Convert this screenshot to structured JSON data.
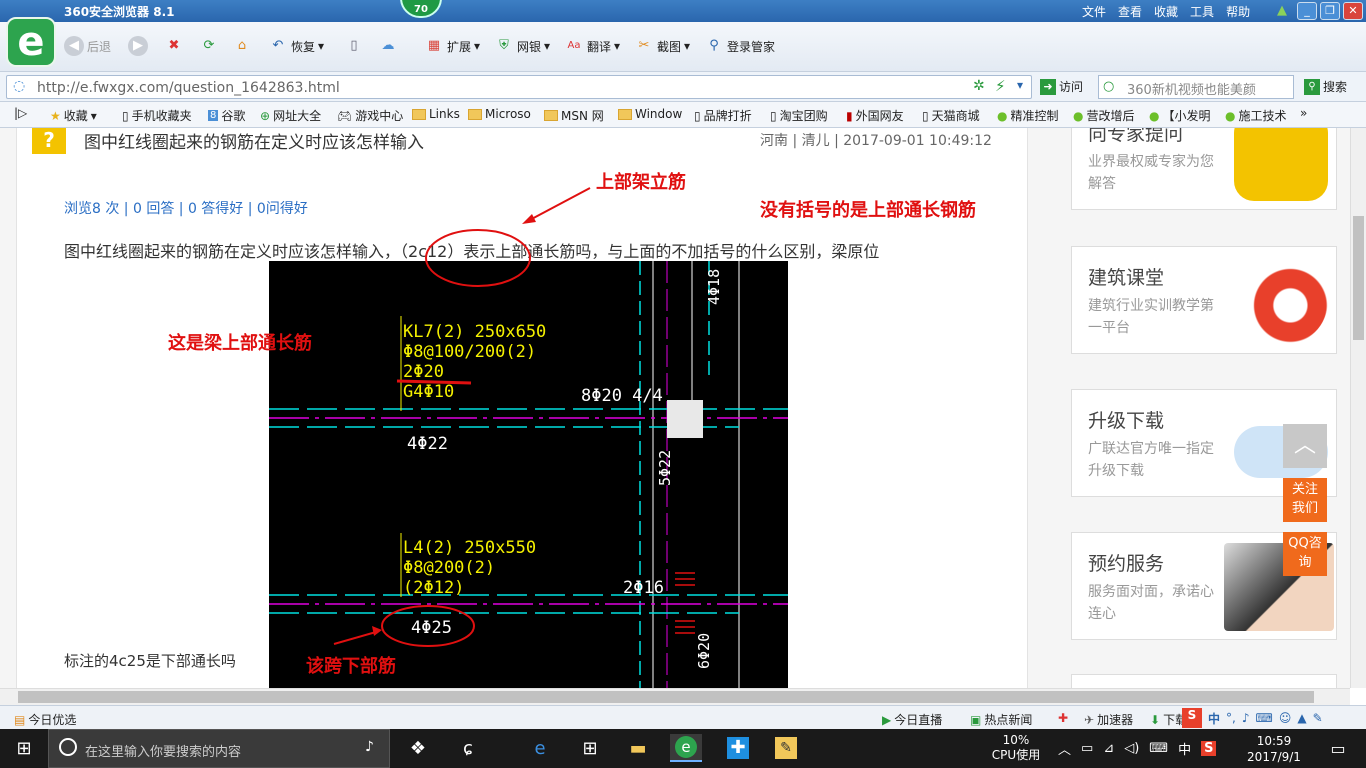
{
  "browser": {
    "title": "360安全浏览器 8.1",
    "badge": "70",
    "menus": [
      "文件",
      "查看",
      "收藏",
      "工具",
      "帮助"
    ],
    "toolbar": {
      "back": "后退",
      "restore": "恢复",
      "extend": "扩展",
      "bank": "网银",
      "translate": "翻译",
      "screenshot": "截图",
      "login": "登录管家"
    },
    "url": "http://e.fwxgx.com/question_1642863.html",
    "go_label": "访问",
    "search_placeholder": "360新机视频也能美颜",
    "search_button": "搜索",
    "bookmarks": [
      "收藏",
      "手机收藏夹",
      "谷歌",
      "网址大全",
      "游戏中心",
      "Links",
      "Microso",
      "MSN 网",
      "Window",
      "品牌打折",
      "淘宝团购",
      "外国网友",
      "天猫商城",
      "精准控制",
      "营改增后",
      "【小发明",
      "施工技术"
    ]
  },
  "question": {
    "title": "图中红线圈起来的钢筋在定义时应该怎样输入",
    "meta": "河南 | 清儿 | 2017-09-01 10:49:12",
    "stats": "浏览8 次 | 0 回答 | 0 答得好 | 0问得好",
    "body_pre": "图中红线圈起来的钢筋在定义时应该怎样输入，",
    "body_paren": "（2c12）",
    "body_post": "表示上部通长筋吗，与上面的不加括号的什么区别，梁原位",
    "footer": "标注的4c25是下部通长吗"
  },
  "annotations": {
    "top_frame": "上部架立筋",
    "no_paren": "没有括号的是上部通长钢筋",
    "beam_top": "这是梁上部通长筋",
    "span_bottom": "该跨下部筋"
  },
  "cad": {
    "kl_lines": [
      "KL7(2) 250x650",
      "Φ8@100/200(2)",
      "2Φ20",
      "G4Φ10"
    ],
    "top_right": "8Φ20 4/4",
    "mid_left": "4Φ22",
    "vertical_top": "4Φ18",
    "vertical_mid": "5Φ22",
    "l_lines": [
      "L4(2) 250x550",
      "Φ8@200(2)",
      "(2Φ12)"
    ],
    "right_mid": "2Φ16",
    "bottom_circle": "4Φ25",
    "vertical_bottom": "6Φ20"
  },
  "sidebar": [
    {
      "title": "向专家提问",
      "desc": "业界最权威专家为您解答"
    },
    {
      "title": "建筑课堂",
      "desc": "建筑行业实训教学第一平台"
    },
    {
      "title": "升级下载",
      "desc": "广联达官方唯一指定升级下载"
    },
    {
      "title": "预约服务",
      "desc": "服务面对面，承诺心连心"
    }
  ],
  "float": {
    "follow": "关注我们",
    "qq": "QQ咨询"
  },
  "statusbar": {
    "left": "今日优选",
    "items": [
      "今日直播",
      "热点新闻",
      "加速器",
      "下载"
    ],
    "ime": "中"
  },
  "taskbar": {
    "search_placeholder": "在这里输入你要搜索的内容",
    "cpu_pct": "10%",
    "cpu_label": "CPU使用",
    "lang": "中",
    "time": "10:59",
    "date": "2017/9/1"
  },
  "colors": {
    "annotation_red": "#e01010",
    "cad_yellow": "#f4f000",
    "cad_cyan": "#00e0e0",
    "cad_magenta": "#e000e0",
    "link_blue": "#2a6ec4"
  }
}
